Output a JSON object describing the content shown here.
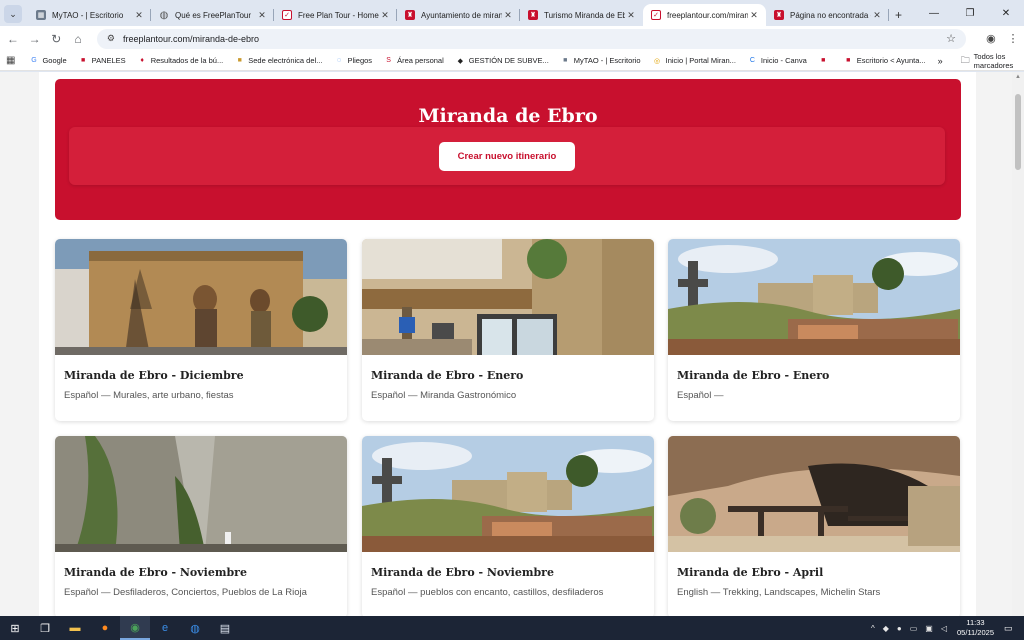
{
  "browser": {
    "tabs": [
      {
        "title": "MyTAO - | Escritorio",
        "icon": "mytao",
        "active": false
      },
      {
        "title": "Qué es FreePlanTour",
        "icon": "globe",
        "active": false
      },
      {
        "title": "Free Plan Tour - Home",
        "icon": "fpt",
        "active": false
      },
      {
        "title": "Ayuntamiento de mirand",
        "icon": "red",
        "active": false
      },
      {
        "title": "Turismo Miranda de Ebr",
        "icon": "red",
        "active": false
      },
      {
        "title": "freeplantour.com/miranda",
        "icon": "fpt",
        "active": true
      },
      {
        "title": "Página no encontrada - A",
        "icon": "red",
        "active": false
      }
    ],
    "url": "freeplantour.com/miranda-de-ebro",
    "bookmarks": [
      {
        "label": "Google",
        "icon": "G",
        "color": "#4285f4"
      },
      {
        "label": "PANELES",
        "icon": "■",
        "color": "#c8102e"
      },
      {
        "label": "Resultados de la bú...",
        "icon": "♦",
        "color": "#c8102e"
      },
      {
        "label": "Sede electrónica del...",
        "icon": "■",
        "color": "#c99a2e"
      },
      {
        "label": "Pliegos",
        "icon": "◌",
        "color": "#1a73e8"
      },
      {
        "label": "Área personal",
        "icon": "S",
        "color": "#c8102e"
      },
      {
        "label": "GESTIÓN DE SUBVE...",
        "icon": "◆",
        "color": "#222222"
      },
      {
        "label": "MyTAO - | Escritorio",
        "icon": "■",
        "color": "#6c7a8b"
      },
      {
        "label": "Inicio | Portal Miran...",
        "icon": "◎",
        "color": "#e0a100"
      },
      {
        "label": "Inicio - Canva",
        "icon": "C",
        "color": "#1a73e8"
      },
      {
        "label": "",
        "icon": "■",
        "color": "#c8102e"
      },
      {
        "label": "Escritorio < Ayunta...",
        "icon": "■",
        "color": "#c8102e"
      }
    ],
    "all_bookmarks_label": "Todos los marcadores"
  },
  "hero": {
    "title": "Miranda de Ebro",
    "button_label": "Crear nuevo itinerario"
  },
  "cards": [
    {
      "title": "Miranda de Ebro - Diciembre",
      "desc": "Español — Murales, arte urbano, fiestas",
      "image": "mural"
    },
    {
      "title": "Miranda de Ebro - Enero",
      "desc": "Español — Miranda Gastronómico",
      "image": "street"
    },
    {
      "title": "Miranda de Ebro - Enero",
      "desc": "Español —",
      "image": "castle"
    },
    {
      "title": "Miranda de Ebro - Noviembre",
      "desc": "Español — Desfiladeros, Conciertos, Pueblos de La Rioja",
      "image": "gorge"
    },
    {
      "title": "Miranda de Ebro - Noviembre",
      "desc": "Español — pueblos con encanto, castillos, desfiladeros",
      "image": "castle"
    },
    {
      "title": "Miranda de Ebro - April",
      "desc": "English — Trekking, Landscapes, Michelin Stars",
      "image": "cave"
    }
  ],
  "taskbar": {
    "time": "11:33",
    "date": "05/11/2025"
  },
  "colors": {
    "brand_red": "#c8102e",
    "hero_panel": "#d41f3a"
  }
}
